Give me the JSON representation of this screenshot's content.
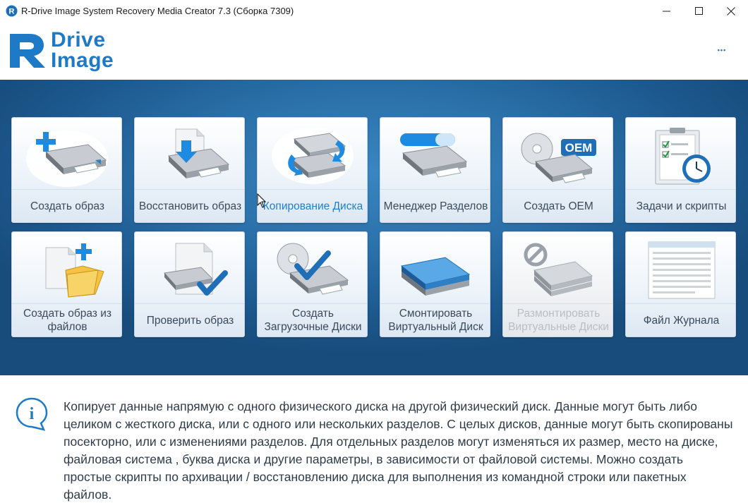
{
  "window": {
    "title": "R-Drive Image System Recovery Media Creator 7.3 (Сборка 7309)",
    "minimize_glyph": "—",
    "maximize_glyph": "☐",
    "close_glyph": "✕"
  },
  "header": {
    "logo_line1": "Drive",
    "logo_line2": "Image",
    "logo_letter": "R",
    "more_glyph": "•••"
  },
  "tiles": [
    {
      "label": "Создать образ",
      "icon": "create-image-icon",
      "state": "normal"
    },
    {
      "label": "Восстановить образ",
      "icon": "restore-image-icon",
      "state": "normal"
    },
    {
      "label": "Копирование Диска",
      "icon": "copy-disk-icon",
      "state": "hover"
    },
    {
      "label": "Менеджер Разделов",
      "icon": "partition-manager-icon",
      "state": "normal"
    },
    {
      "label": "Создать OEM",
      "icon": "create-oem-icon",
      "state": "normal",
      "badge": "OEM"
    },
    {
      "label": "Задачи и скрипты",
      "icon": "tasks-scripts-icon",
      "state": "normal"
    },
    {
      "label_lines": [
        "Создать образ из",
        "файлов"
      ],
      "icon": "create-image-from-files-icon",
      "state": "normal"
    },
    {
      "label": "Проверить образ",
      "icon": "check-image-icon",
      "state": "normal"
    },
    {
      "label_lines": [
        "Создать",
        "Загрузочные Диски"
      ],
      "icon": "create-boot-disks-icon",
      "state": "normal"
    },
    {
      "label_lines": [
        "Смонтировать",
        "Виртуальный Диск"
      ],
      "icon": "mount-virtual-disk-icon",
      "state": "normal"
    },
    {
      "label_lines": [
        "Размонтировать",
        "Виртуальные Диски"
      ],
      "icon": "unmount-virtual-disks-icon",
      "state": "disabled"
    },
    {
      "label": "Файл Журнала",
      "icon": "log-file-icon",
      "state": "normal"
    }
  ],
  "info": {
    "icon": "info-icon",
    "icon_glyph": "i",
    "text": "Копирует данные напрямую с одного физического диска на другой физический диск. Данные могут быть либо целиком с жесткого диска, или с одного или нескольких разделов. С целых дисков, данные могут быть скопированы посекторно, или с изменениями разделов. Для отдельных разделов могут изменяться их размер, место на диске, файловая система , буква диска и другие параметры, в зависимости от файловой системы. Можно создать простые скрипты по архивации / восстановлению диска для выполнения из командной строки или пакетных файлов."
  },
  "colors": {
    "accent": "#1e7ac6",
    "hover_text": "#1f80c8",
    "disabled_text": "#b8bec4",
    "tile_area": "#2a6fa8"
  }
}
